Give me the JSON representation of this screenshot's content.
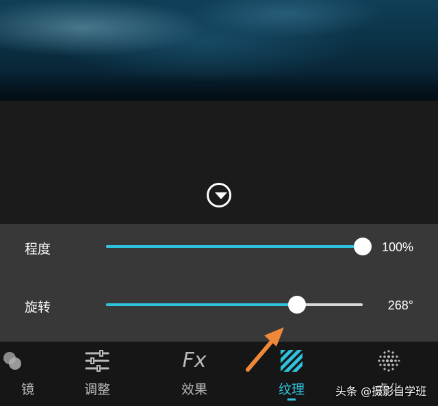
{
  "sliders": [
    {
      "label": "程度",
      "value_text": "100%",
      "level": 1.0
    },
    {
      "label": "旋转",
      "value_text": "268°",
      "level": 0.744
    }
  ],
  "toolbar": {
    "tools": [
      {
        "label": "镜",
        "icon": "filter-circles-icon"
      },
      {
        "label": "调整",
        "icon": "adjust-sliders-icon"
      },
      {
        "label": "效果",
        "icon": "fx-icon",
        "icon_text": "Fx"
      },
      {
        "label": "纹理",
        "icon": "texture-stripes-icon",
        "active": true
      },
      {
        "label": "虚化",
        "icon": "blur-dots-icon"
      }
    ]
  },
  "colors": {
    "accent": "#2fc2dc",
    "arrow": "#f0883a",
    "panel": "#383838",
    "toolbar": "#161616"
  },
  "watermark": "头条 @摄影自学班"
}
